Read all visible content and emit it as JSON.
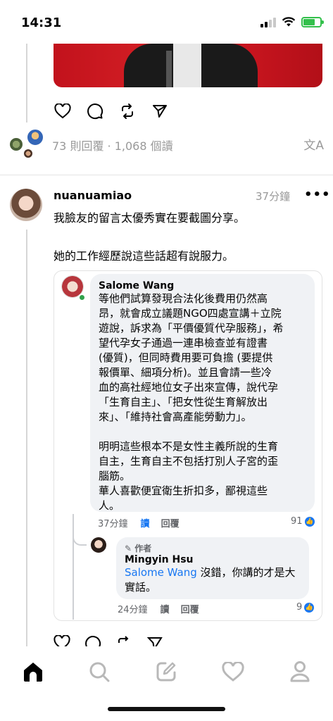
{
  "status_bar": {
    "time": "14:31"
  },
  "post": {
    "replies_summary": "73 則回覆 · 1,068 個讀",
    "translate_icon": "文A"
  },
  "reply_post": {
    "username": "nuanuamiao",
    "timestamp": "37分鐘",
    "more": "•••",
    "lines": [
      "我臉友的留言太優秀實在要截圖分享。",
      "",
      "她的工作經歷說這些話超有說服力。"
    ]
  },
  "screenshot_card": {
    "comment1": {
      "name": "Salome Wang",
      "body": "等他們試算發現合法化後費用仍然高\n昂，就會成立議題NGO四處宣講＋立院\n遊說，訴求為「平價優質代孕服務」，希\n望代孕女子通過一連串檢查並有證書\n(優質)，但同時費用要可負擔 (要提供\n報價單、細項分析)。並且會請一些冷\n血的高社經地位女子出來宣傳，說代孕\n「生育自主」、「把女性從生育解放出\n來」、「維持社會高產能勞動力」。\n\n明明這些根本不是女性主義所說的生育\n自主，生育自主不包括打別人子宮的歪\n腦筋。\n華人喜歡便宜衛生折扣多，鄙視這些\n人。",
      "time": "37分鐘",
      "read": "讀",
      "reply": "回覆",
      "likes": "91"
    },
    "comment2": {
      "author_tag": "作者",
      "name": "Mingyin Hsu",
      "mention": "Salome Wang",
      "body": " 沒錯，你講的才是大\n實話。",
      "time": "24分鐘",
      "read": "讀",
      "reply": "回覆",
      "likes": "9"
    }
  },
  "icons": {
    "like": "heart-icon",
    "comment": "comment-icon",
    "repost": "repost-icon",
    "share": "send-icon"
  },
  "tabbar": [
    "home-icon",
    "search-icon",
    "compose-icon",
    "activity-heart-icon",
    "profile-icon"
  ],
  "colors": {
    "link_blue": "#1877f2",
    "battery_green": "#33c04b",
    "meta_gray": "#999999"
  }
}
